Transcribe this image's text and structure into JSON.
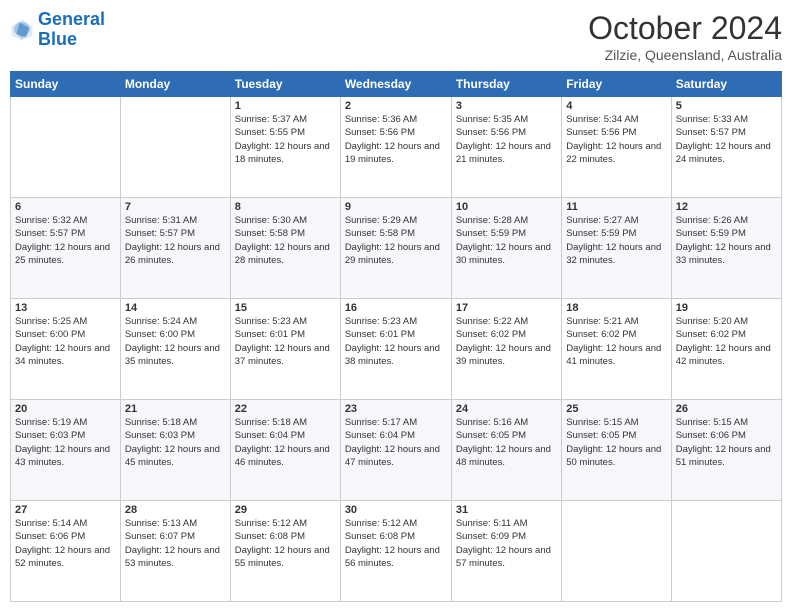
{
  "logo": {
    "line1": "General",
    "line2": "Blue"
  },
  "header": {
    "month": "October 2024",
    "location": "Zilzie, Queensland, Australia"
  },
  "weekdays": [
    "Sunday",
    "Monday",
    "Tuesday",
    "Wednesday",
    "Thursday",
    "Friday",
    "Saturday"
  ],
  "weeks": [
    [
      {
        "day": "",
        "sunrise": "",
        "sunset": "",
        "daylight": ""
      },
      {
        "day": "",
        "sunrise": "",
        "sunset": "",
        "daylight": ""
      },
      {
        "day": "1",
        "sunrise": "Sunrise: 5:37 AM",
        "sunset": "Sunset: 5:55 PM",
        "daylight": "Daylight: 12 hours and 18 minutes."
      },
      {
        "day": "2",
        "sunrise": "Sunrise: 5:36 AM",
        "sunset": "Sunset: 5:56 PM",
        "daylight": "Daylight: 12 hours and 19 minutes."
      },
      {
        "day": "3",
        "sunrise": "Sunrise: 5:35 AM",
        "sunset": "Sunset: 5:56 PM",
        "daylight": "Daylight: 12 hours and 21 minutes."
      },
      {
        "day": "4",
        "sunrise": "Sunrise: 5:34 AM",
        "sunset": "Sunset: 5:56 PM",
        "daylight": "Daylight: 12 hours and 22 minutes."
      },
      {
        "day": "5",
        "sunrise": "Sunrise: 5:33 AM",
        "sunset": "Sunset: 5:57 PM",
        "daylight": "Daylight: 12 hours and 24 minutes."
      }
    ],
    [
      {
        "day": "6",
        "sunrise": "Sunrise: 5:32 AM",
        "sunset": "Sunset: 5:57 PM",
        "daylight": "Daylight: 12 hours and 25 minutes."
      },
      {
        "day": "7",
        "sunrise": "Sunrise: 5:31 AM",
        "sunset": "Sunset: 5:57 PM",
        "daylight": "Daylight: 12 hours and 26 minutes."
      },
      {
        "day": "8",
        "sunrise": "Sunrise: 5:30 AM",
        "sunset": "Sunset: 5:58 PM",
        "daylight": "Daylight: 12 hours and 28 minutes."
      },
      {
        "day": "9",
        "sunrise": "Sunrise: 5:29 AM",
        "sunset": "Sunset: 5:58 PM",
        "daylight": "Daylight: 12 hours and 29 minutes."
      },
      {
        "day": "10",
        "sunrise": "Sunrise: 5:28 AM",
        "sunset": "Sunset: 5:59 PM",
        "daylight": "Daylight: 12 hours and 30 minutes."
      },
      {
        "day": "11",
        "sunrise": "Sunrise: 5:27 AM",
        "sunset": "Sunset: 5:59 PM",
        "daylight": "Daylight: 12 hours and 32 minutes."
      },
      {
        "day": "12",
        "sunrise": "Sunrise: 5:26 AM",
        "sunset": "Sunset: 5:59 PM",
        "daylight": "Daylight: 12 hours and 33 minutes."
      }
    ],
    [
      {
        "day": "13",
        "sunrise": "Sunrise: 5:25 AM",
        "sunset": "Sunset: 6:00 PM",
        "daylight": "Daylight: 12 hours and 34 minutes."
      },
      {
        "day": "14",
        "sunrise": "Sunrise: 5:24 AM",
        "sunset": "Sunset: 6:00 PM",
        "daylight": "Daylight: 12 hours and 35 minutes."
      },
      {
        "day": "15",
        "sunrise": "Sunrise: 5:23 AM",
        "sunset": "Sunset: 6:01 PM",
        "daylight": "Daylight: 12 hours and 37 minutes."
      },
      {
        "day": "16",
        "sunrise": "Sunrise: 5:23 AM",
        "sunset": "Sunset: 6:01 PM",
        "daylight": "Daylight: 12 hours and 38 minutes."
      },
      {
        "day": "17",
        "sunrise": "Sunrise: 5:22 AM",
        "sunset": "Sunset: 6:02 PM",
        "daylight": "Daylight: 12 hours and 39 minutes."
      },
      {
        "day": "18",
        "sunrise": "Sunrise: 5:21 AM",
        "sunset": "Sunset: 6:02 PM",
        "daylight": "Daylight: 12 hours and 41 minutes."
      },
      {
        "day": "19",
        "sunrise": "Sunrise: 5:20 AM",
        "sunset": "Sunset: 6:02 PM",
        "daylight": "Daylight: 12 hours and 42 minutes."
      }
    ],
    [
      {
        "day": "20",
        "sunrise": "Sunrise: 5:19 AM",
        "sunset": "Sunset: 6:03 PM",
        "daylight": "Daylight: 12 hours and 43 minutes."
      },
      {
        "day": "21",
        "sunrise": "Sunrise: 5:18 AM",
        "sunset": "Sunset: 6:03 PM",
        "daylight": "Daylight: 12 hours and 45 minutes."
      },
      {
        "day": "22",
        "sunrise": "Sunrise: 5:18 AM",
        "sunset": "Sunset: 6:04 PM",
        "daylight": "Daylight: 12 hours and 46 minutes."
      },
      {
        "day": "23",
        "sunrise": "Sunrise: 5:17 AM",
        "sunset": "Sunset: 6:04 PM",
        "daylight": "Daylight: 12 hours and 47 minutes."
      },
      {
        "day": "24",
        "sunrise": "Sunrise: 5:16 AM",
        "sunset": "Sunset: 6:05 PM",
        "daylight": "Daylight: 12 hours and 48 minutes."
      },
      {
        "day": "25",
        "sunrise": "Sunrise: 5:15 AM",
        "sunset": "Sunset: 6:05 PM",
        "daylight": "Daylight: 12 hours and 50 minutes."
      },
      {
        "day": "26",
        "sunrise": "Sunrise: 5:15 AM",
        "sunset": "Sunset: 6:06 PM",
        "daylight": "Daylight: 12 hours and 51 minutes."
      }
    ],
    [
      {
        "day": "27",
        "sunrise": "Sunrise: 5:14 AM",
        "sunset": "Sunset: 6:06 PM",
        "daylight": "Daylight: 12 hours and 52 minutes."
      },
      {
        "day": "28",
        "sunrise": "Sunrise: 5:13 AM",
        "sunset": "Sunset: 6:07 PM",
        "daylight": "Daylight: 12 hours and 53 minutes."
      },
      {
        "day": "29",
        "sunrise": "Sunrise: 5:12 AM",
        "sunset": "Sunset: 6:08 PM",
        "daylight": "Daylight: 12 hours and 55 minutes."
      },
      {
        "day": "30",
        "sunrise": "Sunrise: 5:12 AM",
        "sunset": "Sunset: 6:08 PM",
        "daylight": "Daylight: 12 hours and 56 minutes."
      },
      {
        "day": "31",
        "sunrise": "Sunrise: 5:11 AM",
        "sunset": "Sunset: 6:09 PM",
        "daylight": "Daylight: 12 hours and 57 minutes."
      },
      {
        "day": "",
        "sunrise": "",
        "sunset": "",
        "daylight": ""
      },
      {
        "day": "",
        "sunrise": "",
        "sunset": "",
        "daylight": ""
      }
    ]
  ]
}
